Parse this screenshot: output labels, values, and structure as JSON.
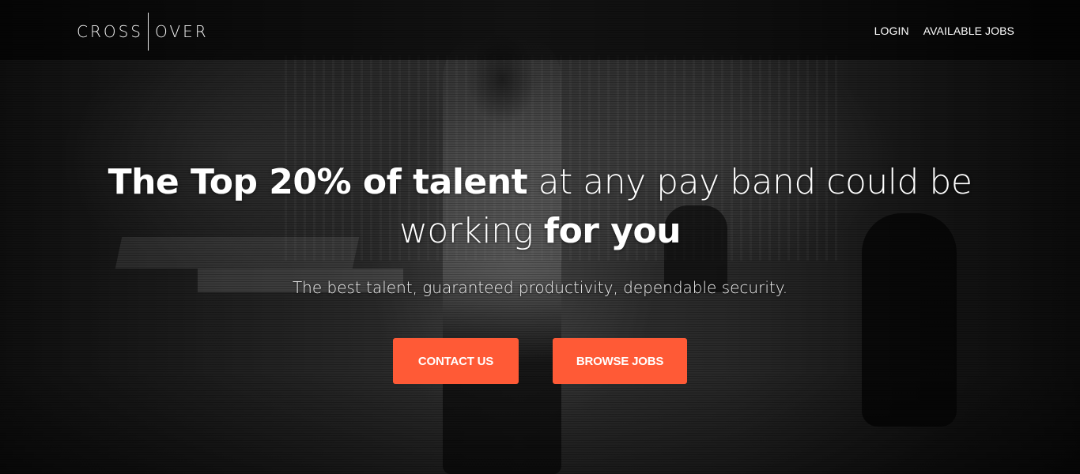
{
  "header": {
    "logo_left": "CROSS",
    "logo_right": "OVER",
    "nav": [
      {
        "label": "LOGIN"
      },
      {
        "label": "AVAILABLE JOBS"
      }
    ]
  },
  "hero": {
    "headline_bold_1": "The Top 20% of talent",
    "headline_light_1": " at any pay band could be",
    "headline_light_2": "working ",
    "headline_bold_2": "for you",
    "subline": "The best talent, guaranteed productivity, dependable security."
  },
  "buttons": {
    "contact": "CONTACT US",
    "browse": "BROWSE JOBS"
  },
  "colors": {
    "accent": "#ff5a36",
    "header_bg": "#000000"
  }
}
